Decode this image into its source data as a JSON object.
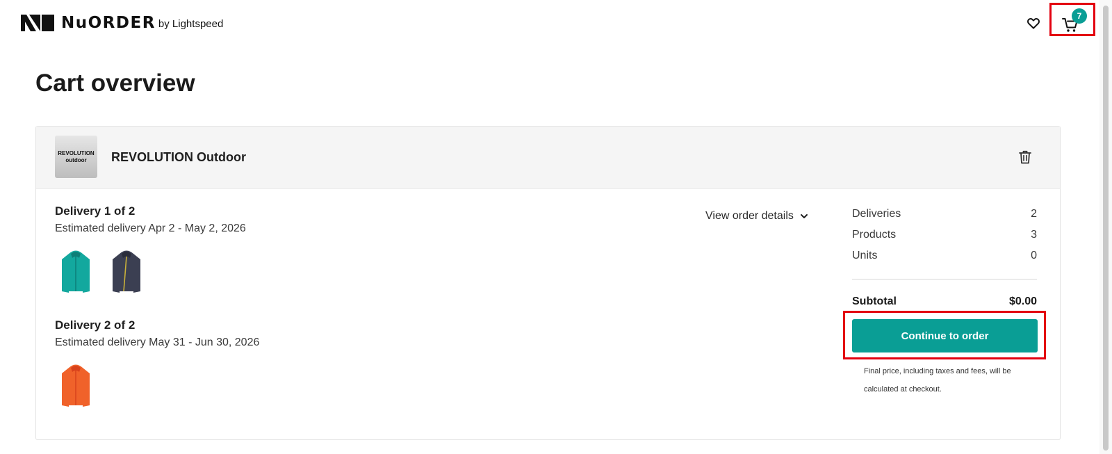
{
  "header": {
    "logo_word": "NuORDER",
    "logo_by": "by Lightspeed",
    "cart_count": "7"
  },
  "page": {
    "title": "Cart overview"
  },
  "brand": {
    "logo_line1": "REVOLUTION",
    "logo_line2": "outdoor",
    "name": "REVOLUTION Outdoor"
  },
  "deliveries": [
    {
      "title": "Delivery 1 of 2",
      "estimate": "Estimated delivery Apr 2 - May 2, 2026",
      "thumbnails": [
        "teal-jacket",
        "navy-jacket"
      ]
    },
    {
      "title": "Delivery 2 of 2",
      "estimate": "Estimated delivery May 31 - Jun 30, 2026",
      "thumbnails": [
        "orange-jacket"
      ]
    }
  ],
  "view_details_label": "View order details",
  "summary": {
    "deliveries_label": "Deliveries",
    "deliveries_value": "2",
    "products_label": "Products",
    "products_value": "3",
    "units_label": "Units",
    "units_value": "0",
    "subtotal_label": "Subtotal",
    "subtotal_value": "$0.00",
    "cta_label": "Continue to order",
    "fine_print_line1": "Final price, including taxes and fees, will be",
    "fine_print_line2": "calculated at checkout."
  },
  "colors": {
    "accent": "#0a9e95",
    "highlight": "#e3000f",
    "teal_jacket": "#13a89e",
    "navy_jacket": "#3b3f52",
    "orange_jacket": "#f0622a"
  }
}
